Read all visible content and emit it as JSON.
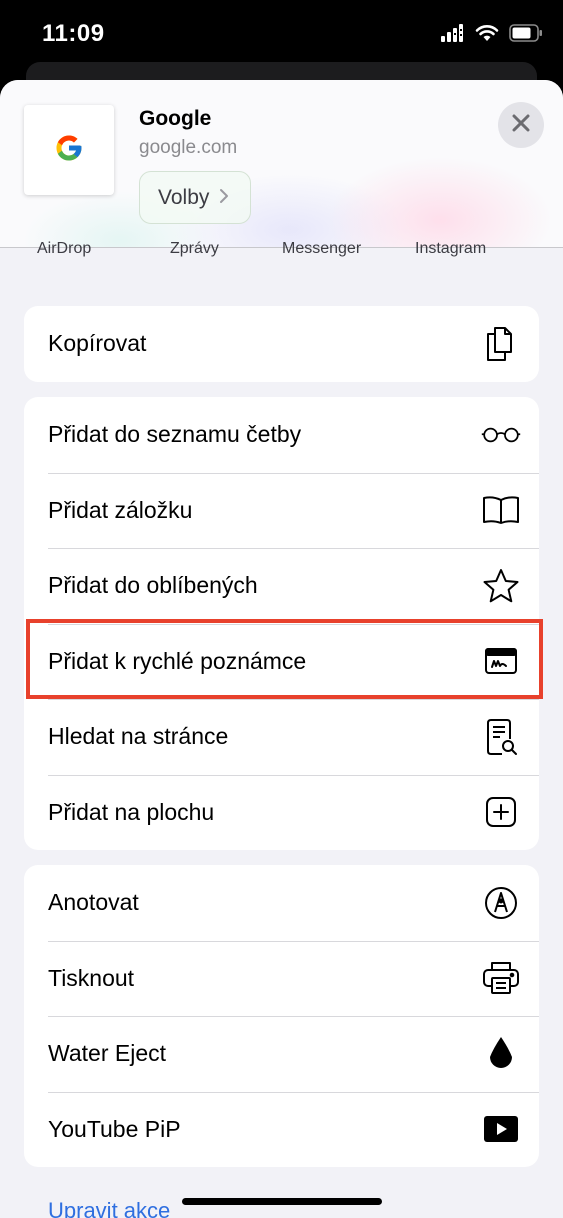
{
  "status_bar": {
    "time": "11:09",
    "icons": [
      "signal-icon",
      "wifi-icon",
      "battery-icon"
    ]
  },
  "header": {
    "site_title": "Google",
    "site_url": "google.com",
    "options_label": "Volby",
    "thumbnail_icon": "google-logo",
    "close_icon": "close-icon"
  },
  "share_targets": [
    "AirDrop",
    "Zprávy",
    "Messenger",
    "Instagram"
  ],
  "groups": [
    {
      "rows": [
        {
          "label": "Kopírovat",
          "icon": "copy-icon"
        }
      ]
    },
    {
      "rows": [
        {
          "label": "Přidat do seznamu četby",
          "icon": "glasses-icon"
        },
        {
          "label": "Přidat záložku",
          "icon": "book-icon"
        },
        {
          "label": "Přidat do oblíbených",
          "icon": "star-icon"
        },
        {
          "label": "Přidat k rychlé poznámce",
          "icon": "quick-note-icon"
        },
        {
          "label": "Hledat na stránce",
          "icon": "find-in-page-icon"
        },
        {
          "label": "Přidat na plochu",
          "icon": "add-square-icon"
        }
      ]
    },
    {
      "rows": [
        {
          "label": "Anotovat",
          "icon": "markup-icon"
        },
        {
          "label": "Tisknout",
          "icon": "printer-icon"
        },
        {
          "label": "Water Eject",
          "icon": "water-drop-icon"
        },
        {
          "label": "YouTube PiP",
          "icon": "play-icon"
        }
      ]
    }
  ],
  "footer": {
    "edit_actions_label": "Upravit akce"
  },
  "colors": {
    "highlight": "#e8412c",
    "link": "#2f6fe0",
    "sheet_bg": "#f2f2f7"
  }
}
